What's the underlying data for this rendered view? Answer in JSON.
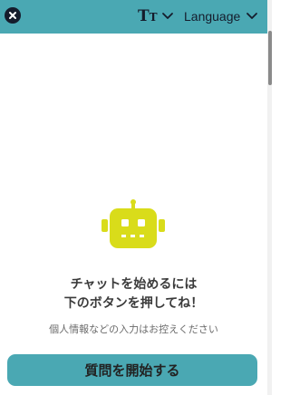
{
  "header": {
    "font_size_glyph_big": "T",
    "font_size_glyph_small": "T",
    "language_label": "Language"
  },
  "main": {
    "headline_line1": "チャットを始めるには",
    "headline_line2": "下のボタンを押してね！",
    "notice": "個人情報などの入力はお控えください",
    "start_button_label": "質問を開始する"
  },
  "icons": {
    "close": "close-icon",
    "font_size": "font-size-icon",
    "chevron": "chevron-down-icon",
    "robot": "robot-icon"
  },
  "colors": {
    "accent": "#4aa8b3",
    "robot": "#d9dc1a",
    "dark": "#151c2c"
  }
}
